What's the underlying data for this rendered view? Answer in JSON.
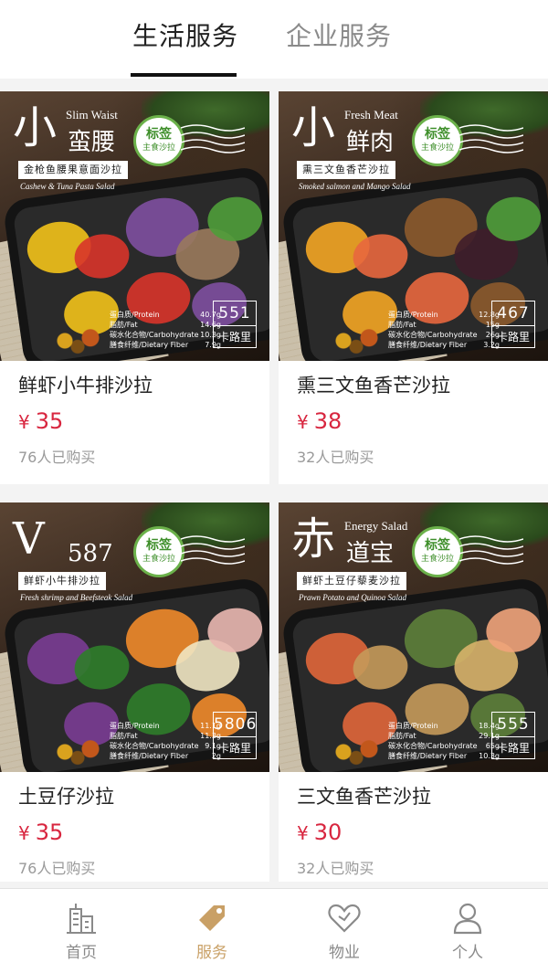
{
  "tabs": {
    "active": "生活服务",
    "inactive": "企业服务"
  },
  "products": [
    {
      "brand_big": "小",
      "brand_mid": "蛮腰",
      "brand_en": "Slim Waist",
      "stamp_a": "标签",
      "stamp_b": "主食沙拉",
      "caption_cn": "金枪鱼腰果意面沙拉",
      "caption_en": "Cashew & Tuna Pasta Salad",
      "kcal": "551",
      "kcal_unit": "卡路里",
      "nutrition": [
        {
          "k": "蛋白质/Protein",
          "v": "40.7g"
        },
        {
          "k": "脂肪/Fat",
          "v": "14.6g"
        },
        {
          "k": "碳水化合物/Carbohydrate",
          "v": "10.3g"
        },
        {
          "k": "膳食纤维/Dietary Fiber",
          "v": "7.9g"
        }
      ],
      "title": "鲜虾小牛排沙拉",
      "price_symbol": "¥",
      "price": "35",
      "sold": "76人已购买",
      "colors": [
        "#f2c21a",
        "#d8342a",
        "#7e4fa0",
        "#9a7a5c",
        "#4f9d3a"
      ]
    },
    {
      "brand_big": "小",
      "brand_mid": "鲜肉",
      "brand_en": "Fresh Meat",
      "stamp_a": "标签",
      "stamp_b": "主食沙拉",
      "caption_cn": "熏三文鱼香芒沙拉",
      "caption_en": "Smoked salmon and Mango Salad",
      "kcal": "467",
      "kcal_unit": "卡路里",
      "nutrition": [
        {
          "k": "蛋白质/Protein",
          "v": "12.8g"
        },
        {
          "k": "脂肪/Fat",
          "v": "15g"
        },
        {
          "k": "碳水化合物/Carbohydrate",
          "v": "26g"
        },
        {
          "k": "膳食纤维/Dietary Fiber",
          "v": "3.2g"
        }
      ],
      "title": "熏三文鱼香芒沙拉",
      "price_symbol": "¥",
      "price": "38",
      "sold": "32人已购买",
      "colors": [
        "#f3a524",
        "#e8673e",
        "#8c5a2c",
        "#3e1d2a",
        "#4f9d3a"
      ]
    },
    {
      "brand_big": "V",
      "brand_mid": "587",
      "brand_en": "",
      "stamp_a": "标签",
      "stamp_b": "主食沙拉",
      "caption_cn": "鲜虾小牛排沙拉",
      "caption_en": "Fresh shrimp and Beefsteak Salad",
      "kcal": "5806",
      "kcal_unit": "卡路里",
      "nutrition": [
        {
          "k": "蛋白质/Protein",
          "v": "11.1g"
        },
        {
          "k": "脂肪/Fat",
          "v": "11.3g"
        },
        {
          "k": "碳水化合物/Carbohydrate",
          "v": "9.1g"
        },
        {
          "k": "膳食纤维/Dietary Fiber",
          "v": "2g"
        }
      ],
      "title": "土豆仔沙拉",
      "price_symbol": "¥",
      "price": "35",
      "sold": "76人已购买",
      "colors": [
        "#7a3c94",
        "#2f7d2a",
        "#f08a2a",
        "#f0e6c2",
        "#e9b7b0"
      ]
    },
    {
      "brand_big": "赤",
      "brand_mid": "道宝",
      "brand_en": "Energy Salad",
      "stamp_a": "标签",
      "stamp_b": "主食沙拉",
      "caption_cn": "鲜虾土豆仔藜麦沙拉",
      "caption_en": "Prawn Potato and Quinoa Salad",
      "kcal": "555",
      "kcal_unit": "卡路里",
      "nutrition": [
        {
          "k": "蛋白质/Protein",
          "v": "18.4g"
        },
        {
          "k": "脂肪/Fat",
          "v": "29.1g"
        },
        {
          "k": "碳水化合物/Carbohydrate",
          "v": "65g"
        },
        {
          "k": "膳食纤维/Dietary Fiber",
          "v": "10.3g"
        }
      ],
      "title": "三文鱼香芒沙拉",
      "price_symbol": "¥",
      "price": "30",
      "sold": "32人已购买",
      "colors": [
        "#e0663a",
        "#c59a5a",
        "#5d7f3a",
        "#d8b26a",
        "#f0a37a"
      ]
    }
  ],
  "nav": [
    {
      "label": "首页",
      "icon": "building-icon"
    },
    {
      "label": "服务",
      "icon": "tag-icon"
    },
    {
      "label": "物业",
      "icon": "heart-icon"
    },
    {
      "label": "个人",
      "icon": "person-icon"
    }
  ],
  "colors": {
    "accent": "#c9a066",
    "price": "#d8263f",
    "tab_underline": "#111111"
  }
}
